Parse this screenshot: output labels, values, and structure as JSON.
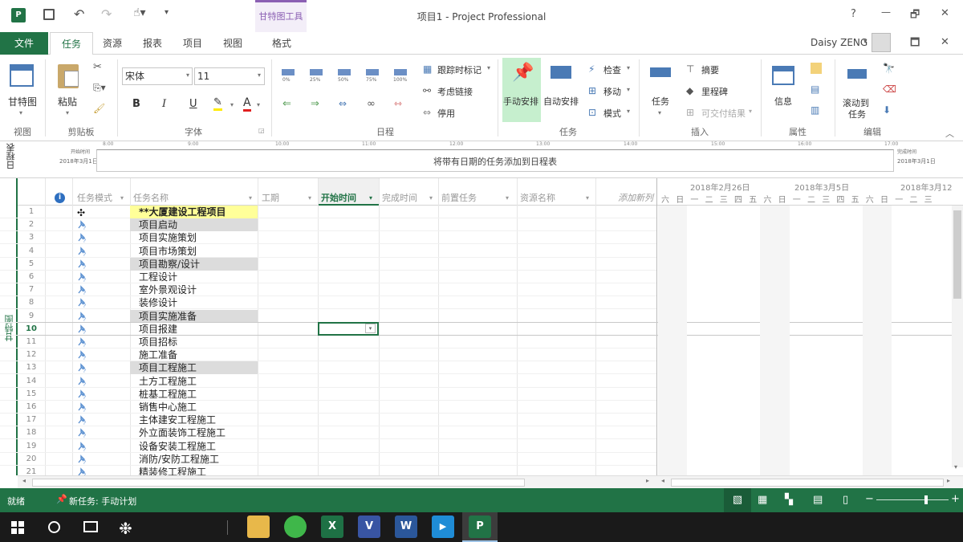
{
  "window": {
    "title": "项目1 - Project Professional",
    "context_tab_group": "甘特图工具",
    "user": "Daisy ZENG",
    "help": "?",
    "minimize": "—",
    "restore": "🗗",
    "close": "✕",
    "user_dropdown": "▾",
    "ribbon_display": "🗖",
    "ribbon_close": "✕"
  },
  "tabs": [
    "文件",
    "任务",
    "资源",
    "报表",
    "项目",
    "视图",
    "格式"
  ],
  "ribbon": {
    "view_group": {
      "button": "甘特图",
      "label": "视图"
    },
    "clipboard": {
      "paste": "粘贴",
      "label": "剪贴板"
    },
    "font": {
      "name": "宋体",
      "size": "11",
      "bold": "B",
      "italic": "I",
      "underline": "U",
      "fontcolor": "A",
      "label": "字体"
    },
    "schedule": {
      "pcts": [
        "0%",
        "25%",
        "50%",
        "75%",
        "100%"
      ],
      "track": "跟踪时标记",
      "respect": "考虑链接",
      "inactivate": "停用",
      "label": "日程"
    },
    "tasks": {
      "manual": "手动安排",
      "auto": "自动安排",
      "inspect": "检查",
      "move": "移动",
      "mode": "模式",
      "label": "任务"
    },
    "insert": {
      "task": "任务",
      "summary": "摘要",
      "milestone": "里程碑",
      "deliverable": "可交付结果",
      "label": "插入"
    },
    "properties": {
      "info": "信息",
      "label": "属性"
    },
    "editing": {
      "scroll": "滚动到",
      "scroll2": "任务",
      "label": "编辑"
    }
  },
  "timeline": {
    "side_label": "日程表",
    "start_label": "开始时间",
    "start_date": "2018年3月1日",
    "end_label": "完成时间",
    "end_date": "2018年3月1日",
    "placeholder": "将带有日期的任务添加到日程表",
    "ticks": [
      "8:00",
      "9:00",
      "10:00",
      "11:00",
      "12:00",
      "13:00",
      "14:00",
      "15:00",
      "16:00",
      "17:00"
    ]
  },
  "grid": {
    "side_label": "甘特图",
    "columns": {
      "mode": "任务模式",
      "name": "任务名称",
      "duration": "工期",
      "start": "开始时间",
      "finish": "完成时间",
      "predecessors": "前置任务",
      "resources": "资源名称",
      "add": "添加新列"
    },
    "rows": [
      {
        "n": "1",
        "name": "**大厦建设工程项目",
        "type": "project"
      },
      {
        "n": "2",
        "name": "项目启动",
        "type": "summary"
      },
      {
        "n": "3",
        "name": "项目实施策划",
        "type": "task"
      },
      {
        "n": "4",
        "name": "项目市场策划",
        "type": "task"
      },
      {
        "n": "5",
        "name": "项目勘察/设计",
        "type": "summary"
      },
      {
        "n": "6",
        "name": "工程设计",
        "type": "task"
      },
      {
        "n": "7",
        "name": "室外景观设计",
        "type": "task"
      },
      {
        "n": "8",
        "name": "装修设计",
        "type": "task"
      },
      {
        "n": "9",
        "name": "项目实施准备",
        "type": "summary"
      },
      {
        "n": "10",
        "name": "项目报建",
        "type": "task"
      },
      {
        "n": "11",
        "name": "项目招标",
        "type": "task"
      },
      {
        "n": "12",
        "name": "施工准备",
        "type": "task"
      },
      {
        "n": "13",
        "name": "项目工程施工",
        "type": "summary"
      },
      {
        "n": "14",
        "name": "土方工程施工",
        "type": "task"
      },
      {
        "n": "15",
        "name": "桩基工程施工",
        "type": "task"
      },
      {
        "n": "16",
        "name": "销售中心施工",
        "type": "task"
      },
      {
        "n": "17",
        "name": "主体建安工程施工",
        "type": "task"
      },
      {
        "n": "18",
        "name": "外立面装饰工程施工",
        "type": "task"
      },
      {
        "n": "19",
        "name": "设备安装工程施工",
        "type": "task"
      },
      {
        "n": "20",
        "name": "消防/安防工程施工",
        "type": "task"
      },
      {
        "n": "21",
        "name": "精装修工程施工",
        "type": "task"
      }
    ],
    "gantt": {
      "weeks": [
        "2018年2月26日",
        "2018年3月5日",
        "2018年3月12"
      ],
      "days": [
        "六",
        "日",
        "一",
        "二",
        "三",
        "四",
        "五",
        "六",
        "日",
        "一",
        "二",
        "三",
        "四",
        "五",
        "六",
        "日",
        "一",
        "二",
        "三"
      ]
    }
  },
  "status": {
    "ready": "就绪",
    "new_task": "新任务: 手动计划"
  },
  "colors": {
    "green": "#217346",
    "accent_purple": "#8b5fb3",
    "selected_tab": "#217346",
    "summary_bg": "#dcdcdc",
    "project_bg": "#ffff99"
  },
  "taskbar": {
    "icons": [
      "windows-icon",
      "search-icon",
      "taskview-icon",
      "fan-icon",
      "explorer-icon",
      "browser-icon",
      "excel-icon",
      "visio-icon",
      "word-icon",
      "video-icon",
      "project-icon"
    ]
  }
}
